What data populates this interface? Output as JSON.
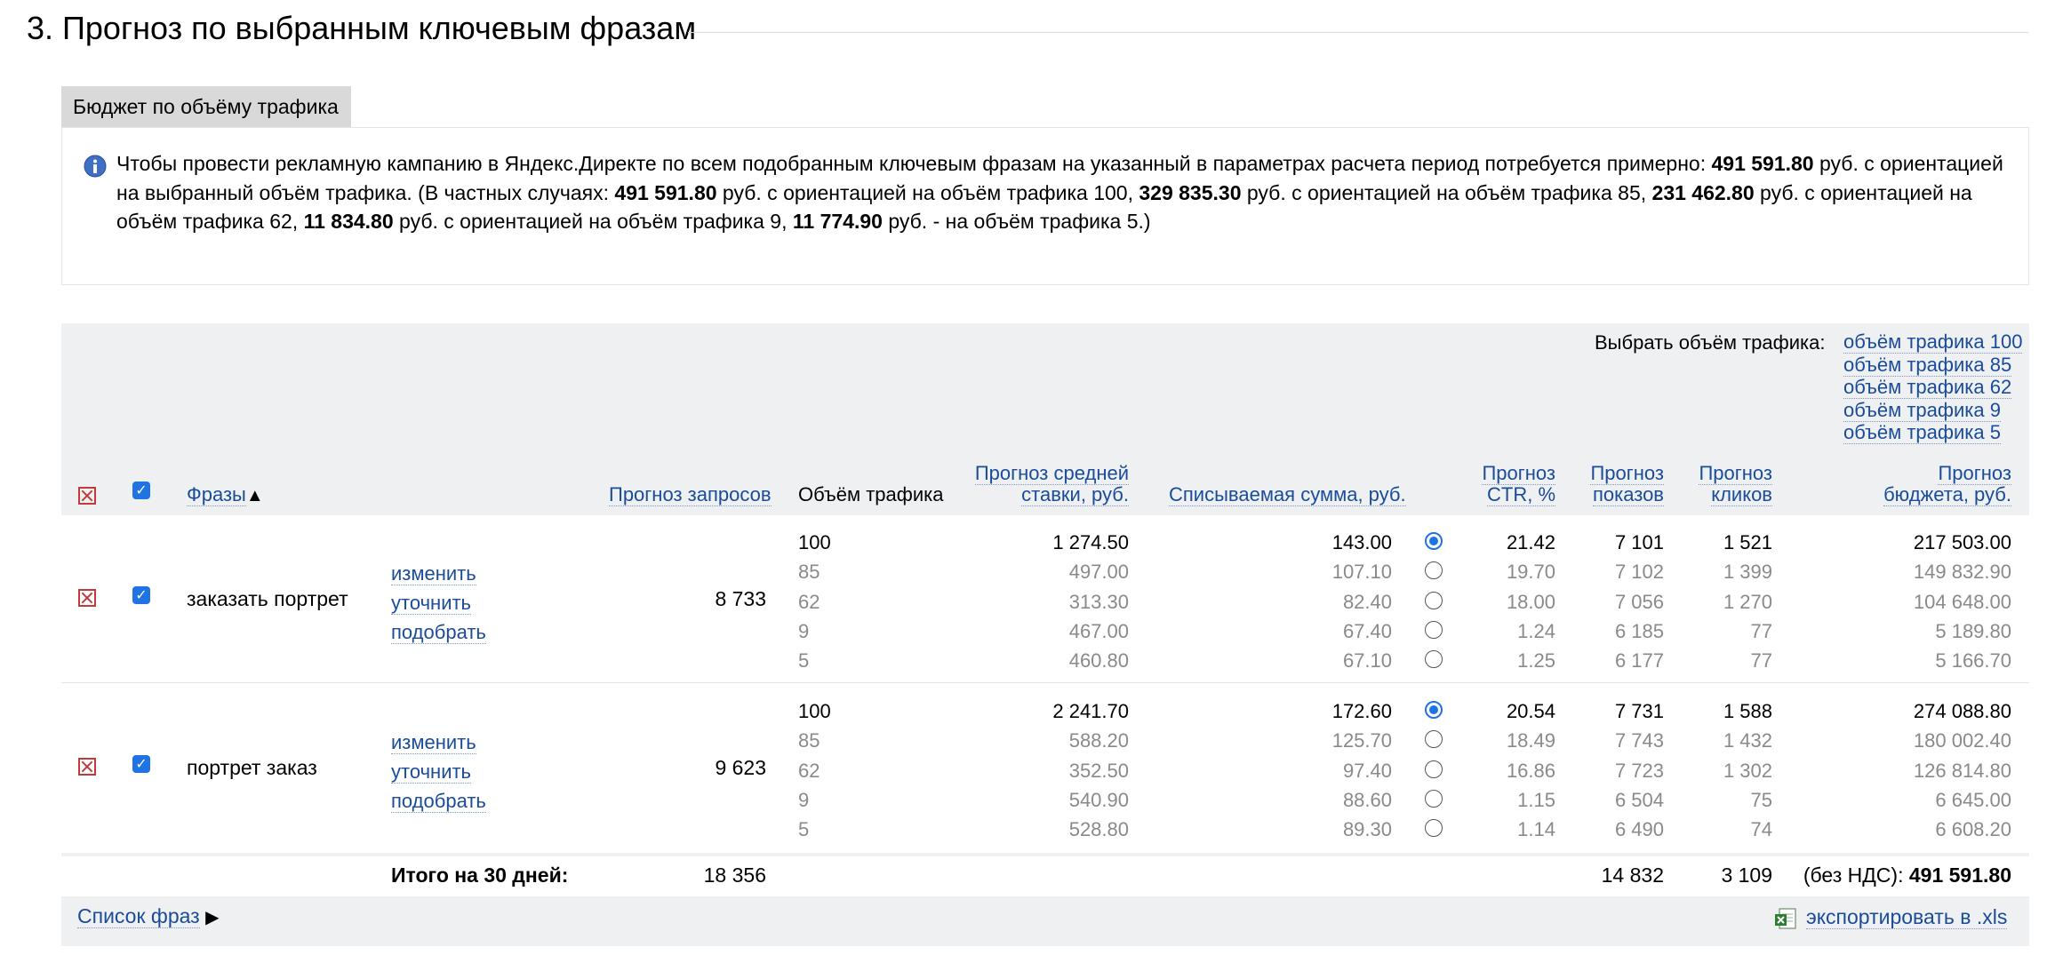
{
  "section": {
    "title": "3. Прогноз по выбранным ключевым фразам"
  },
  "tab": {
    "label": "Бюджет по объёму трафика"
  },
  "info": {
    "p1": "Чтобы провести рекламную кампанию в Яндекс.Директе по всем подобранным ключевым фразам на указанный в параметрах расчета период потребуется примерно: ",
    "v_total": "491 591.80",
    "p2": " руб. с ориентацией на выбранный объём трафика. (В частных случаях: ",
    "v100": "491 591.80",
    "p3": " руб. с ориентацией на объём трафика 100, ",
    "v85": "329 835.30",
    "p4": " руб. с ориентацией на объём трафика 85, ",
    "v62": "231 462.80",
    "p5": " руб. с ориентацией на объём трафика 62, ",
    "v9": "11 834.80",
    "p6": " руб. с ориентацией на объём трафика 9, ",
    "v5": "11 774.90",
    "p7": " руб. - на объём трафика 5.)"
  },
  "select_volume": {
    "label": "Выбрать объём трафика:",
    "options": [
      "объём трафика 100",
      "объём трафика 85",
      "объём трафика 62",
      "объём трафика 9",
      "объём трафика 5"
    ]
  },
  "columns": {
    "phrases": "Фразы",
    "sort_arrow": "▲",
    "requests": "Прогноз запросов",
    "volume": "Объём трафика",
    "bid_1": "Прогноз средней",
    "bid_2": "ставки, руб.",
    "charge": "Списываемая сумма, руб.",
    "ctr_1": "Прогноз",
    "ctr_2": "CTR, %",
    "shows_1": "Прогноз",
    "shows_2": "показов",
    "clicks_1": "Прогноз",
    "clicks_2": "кликов",
    "budget_1": "Прогноз",
    "budget_2": "бюджета, руб."
  },
  "actions": {
    "change": "изменить",
    "refine": "уточнить",
    "pick": "подобрать"
  },
  "rows": [
    {
      "phrase": "заказать портрет",
      "requests": "8 733",
      "lines": [
        {
          "vol": "100",
          "bid": "1 274.50",
          "charge": "143.00",
          "ctr": "21.42",
          "shows": "7 101",
          "clicks": "1 521",
          "budget": "217 503.00"
        },
        {
          "vol": "85",
          "bid": "497.00",
          "charge": "107.10",
          "ctr": "19.70",
          "shows": "7 102",
          "clicks": "1 399",
          "budget": "149 832.90"
        },
        {
          "vol": "62",
          "bid": "313.30",
          "charge": "82.40",
          "ctr": "18.00",
          "shows": "7 056",
          "clicks": "1 270",
          "budget": "104 648.00"
        },
        {
          "vol": "9",
          "bid": "467.00",
          "charge": "67.40",
          "ctr": "1.24",
          "shows": "6 185",
          "clicks": "77",
          "budget": "5 189.80"
        },
        {
          "vol": "5",
          "bid": "460.80",
          "charge": "67.10",
          "ctr": "1.25",
          "shows": "6 177",
          "clicks": "77",
          "budget": "5 166.70"
        }
      ]
    },
    {
      "phrase": "портрет заказ",
      "requests": "9 623",
      "lines": [
        {
          "vol": "100",
          "bid": "2 241.70",
          "charge": "172.60",
          "ctr": "20.54",
          "shows": "7 731",
          "clicks": "1 588",
          "budget": "274 088.80"
        },
        {
          "vol": "85",
          "bid": "588.20",
          "charge": "125.70",
          "ctr": "18.49",
          "shows": "7 743",
          "clicks": "1 432",
          "budget": "180 002.40"
        },
        {
          "vol": "62",
          "bid": "352.50",
          "charge": "97.40",
          "ctr": "16.86",
          "shows": "7 723",
          "clicks": "1 302",
          "budget": "126 814.80"
        },
        {
          "vol": "9",
          "bid": "540.90",
          "charge": "88.60",
          "ctr": "1.15",
          "shows": "6 504",
          "clicks": "75",
          "budget": "6 645.00"
        },
        {
          "vol": "5",
          "bid": "528.80",
          "charge": "89.30",
          "ctr": "1.14",
          "shows": "6 490",
          "clicks": "74",
          "budget": "6 608.20"
        }
      ]
    }
  ],
  "totals": {
    "label": "Итого на 30 дней:",
    "requests": "18 356",
    "shows": "14 832",
    "clicks": "3 109",
    "budget_prefix": "(без НДС): ",
    "budget": "491 591.80"
  },
  "footer": {
    "phrase_list": "Список фраз",
    "arrow": "▶",
    "export": "экспортировать в .xls"
  },
  "colors": {
    "link": "#1a4c9a",
    "checkbox": "#1f73e4",
    "remove": "#c23b3b",
    "header_bg": "#eef0f2"
  },
  "icons": [
    "info-icon",
    "remove-icon",
    "checkbox-icon",
    "sort-up-icon",
    "play-arrow-icon",
    "xls-icon"
  ]
}
